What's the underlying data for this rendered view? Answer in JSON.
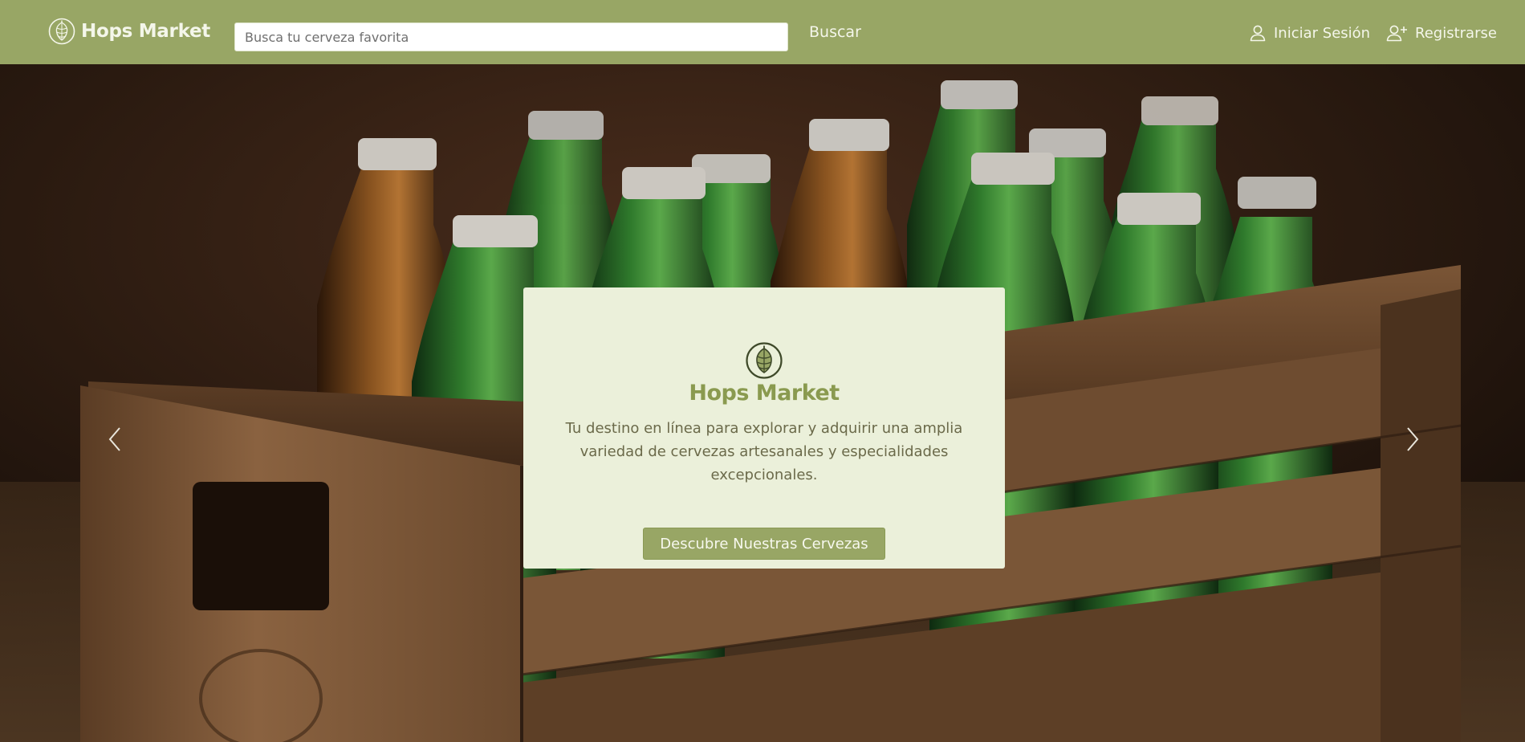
{
  "header": {
    "brand": "Hops Market",
    "search": {
      "placeholder": "Busca tu cerveza favorita",
      "value": "",
      "button_label": "Buscar"
    },
    "login_label": "Iniciar Sesión",
    "register_label": "Registrarse"
  },
  "hero": {
    "card": {
      "brand": "Hops Market",
      "text": "Tu destino en línea para explorar y adquirir una amplia variedad de cervezas artesanales y especialidades excepcionales.",
      "cta_label": "Descubre Nuestras Cervezas"
    },
    "prev_icon": "chevron-left-icon",
    "next_icon": "chevron-right-icon"
  },
  "icons": {
    "brand_logo": "hop-logo-icon",
    "login": "user-icon",
    "register": "user-plus-icon"
  },
  "colors": {
    "header_bg": "#98a665",
    "card_bg": "#ebf0da",
    "accent": "#98a665",
    "brand_green": "#8a9a4f",
    "body_text": "#6b6a4a"
  }
}
